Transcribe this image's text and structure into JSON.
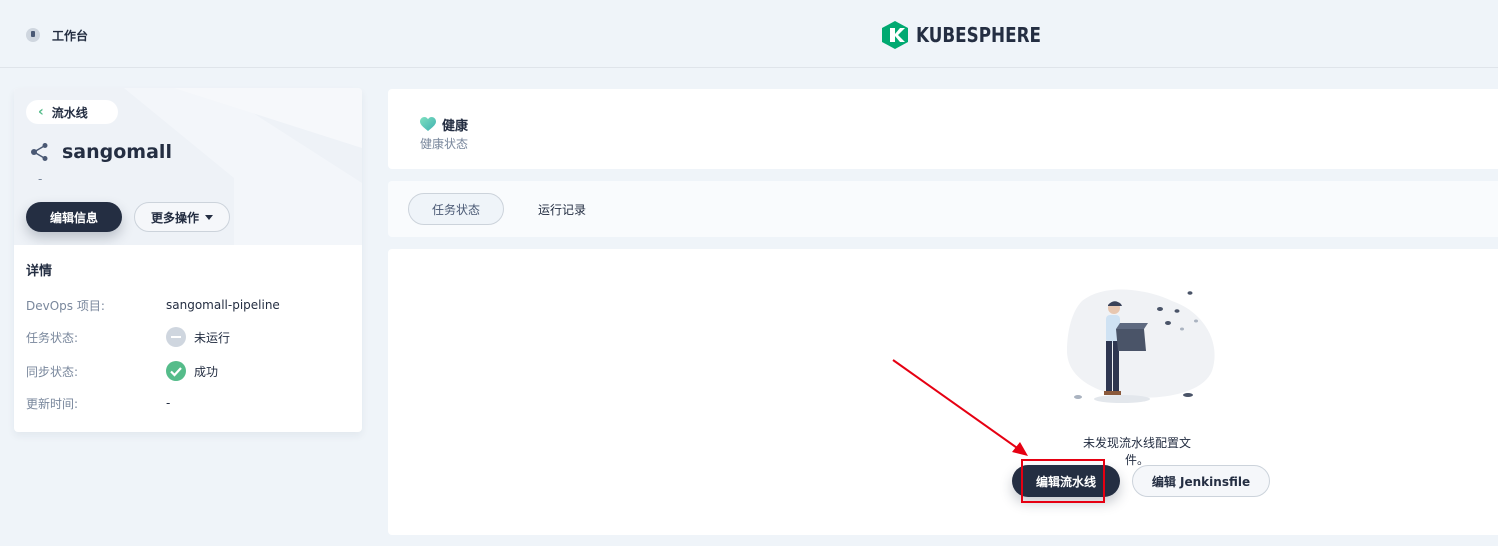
{
  "header": {
    "workbench_label": "工作台",
    "brand_name": "KUBESPHERE",
    "brand_color": "#00a971"
  },
  "sidebar": {
    "back_label": "流水线",
    "pipeline_name": "sangomall",
    "description": "-",
    "edit_info_button": "编辑信息",
    "more_actions_button": "更多操作",
    "details_title": "详情",
    "details": [
      {
        "key": "DevOps 项目:",
        "value": "sangomall-pipeline"
      },
      {
        "key": "任务状态:",
        "value": "未运行",
        "status_icon": "not-running-icon"
      },
      {
        "key": "同步状态:",
        "value": "成功",
        "status_icon": "success-check-icon"
      },
      {
        "key": "更新时间:",
        "value": "-"
      }
    ]
  },
  "health": {
    "status": "健康",
    "label": "健康状态",
    "icon": "heart-icon"
  },
  "tabs": [
    {
      "label": "任务状态",
      "active": true
    },
    {
      "label": "运行记录",
      "active": false
    }
  ],
  "empty_state": {
    "message": "未发现流水线配置文件。",
    "edit_pipeline_button": "编辑流水线",
    "edit_jenkinsfile_button": "编辑 Jenkinsfile"
  },
  "colors": {
    "primary_dark": "#242e42",
    "success_green": "#55bc8a",
    "annotation_red": "#e60012"
  }
}
